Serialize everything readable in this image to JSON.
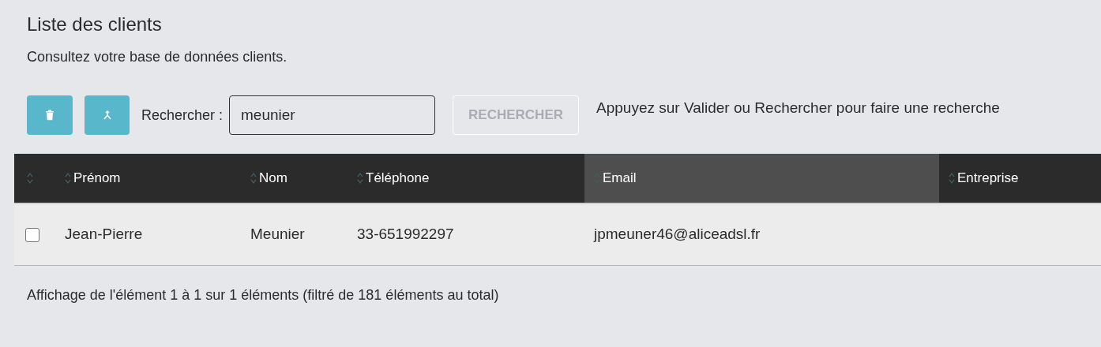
{
  "title": "Liste des clients",
  "subtitle": "Consultez votre base de données clients.",
  "toolbar": {
    "search_label": "Rechercher :",
    "search_value": "meunier",
    "search_button": {
      "label": "RECHERCHER",
      "disabled": true
    },
    "hint": "Appuyez sur Valider ou Rechercher pour faire une recherche"
  },
  "table": {
    "columns": [
      {
        "label": "Prénom",
        "sorted": false
      },
      {
        "label": "Nom",
        "sorted": false
      },
      {
        "label": "Téléphone",
        "sorted": false
      },
      {
        "label": "Email",
        "sorted": true
      },
      {
        "label": "Entreprise",
        "sorted": false
      }
    ],
    "rows": [
      {
        "checked": false,
        "cells": [
          "Jean-Pierre",
          "Meunier",
          "33-651992297",
          "jpmeuner46@aliceadsl.fr"
        ]
      }
    ]
  },
  "footer": "Affichage de l'élément 1 à 1 sur 1 éléments (filtré de 181 éléments au total)"
}
